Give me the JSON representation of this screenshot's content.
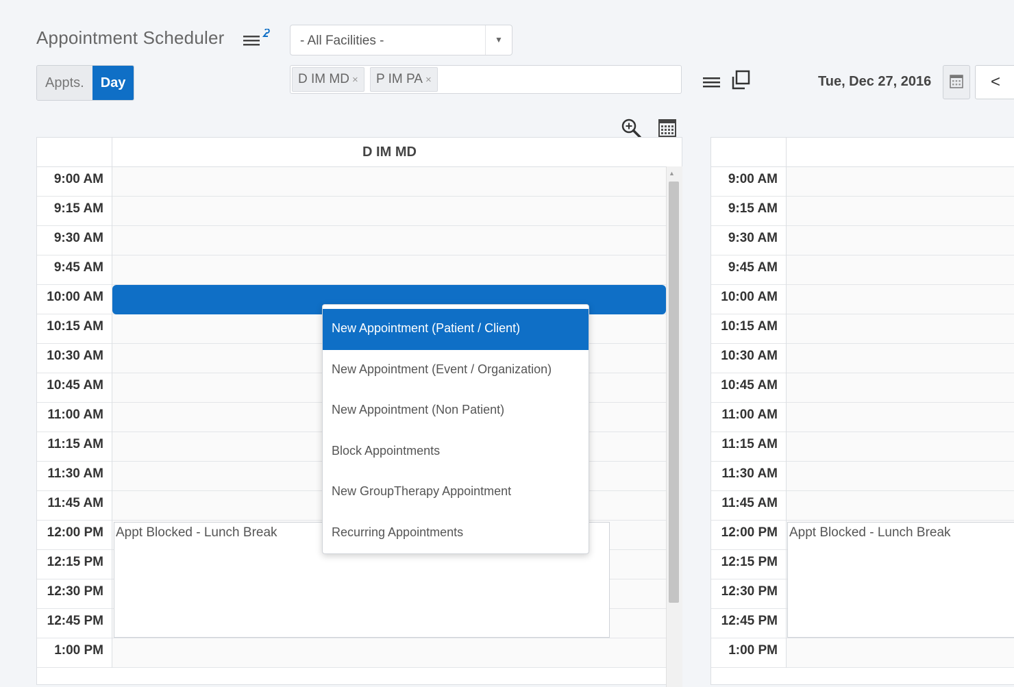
{
  "header": {
    "title": "Appointment Scheduler",
    "facility": {
      "selected": "- All Facilities -"
    },
    "view_toggle": {
      "appts_label": "Appts.",
      "day_label": "Day",
      "active": "Day"
    },
    "providers": [
      {
        "label": "D IM MD",
        "remove": "×"
      },
      {
        "label": "P IM PA",
        "remove": "×"
      }
    ],
    "date_label": "Tue, Dec 27, 2016",
    "prev_label": "<",
    "icons": [
      "list-menu-icon",
      "window-icon",
      "calendar-icon",
      "chevron-left-icon",
      "zoom-in-icon",
      "calendar-grid-icon"
    ]
  },
  "schedule_left": {
    "provider": "D IM MD",
    "times": [
      "9:00 AM",
      "9:15 AM",
      "9:30 AM",
      "9:45 AM",
      "10:00 AM",
      "10:15 AM",
      "10:30 AM",
      "10:45 AM",
      "11:00 AM",
      "11:15 AM",
      "11:30 AM",
      "11:45 AM",
      "12:00 PM",
      "12:15 PM",
      "12:30 PM",
      "12:45 PM",
      "1:00 PM"
    ],
    "block_label": "Appt Blocked - Lunch Break"
  },
  "schedule_right": {
    "provider": "",
    "times": [
      "9:00 AM",
      "9:15 AM",
      "9:30 AM",
      "9:45 AM",
      "10:00 AM",
      "10:15 AM",
      "10:30 AM",
      "10:45 AM",
      "11:00 AM",
      "11:15 AM",
      "11:30 AM",
      "11:45 AM",
      "12:00 PM",
      "12:15 PM",
      "12:30 PM",
      "12:45 PM",
      "1:00 PM"
    ],
    "block_label": "Appt Blocked - Lunch Break"
  },
  "context_menu": {
    "items": [
      "New Appointment (Patient / Client)",
      "New Appointment (Event / Organization)",
      "New Appointment (Non Patient)",
      "Block Appointments",
      "New GroupTherapy Appointment",
      "Recurring Appointments"
    ],
    "active_index": 0
  },
  "colors": {
    "accent": "#0f6fc6",
    "background": "#f3f5f8"
  }
}
